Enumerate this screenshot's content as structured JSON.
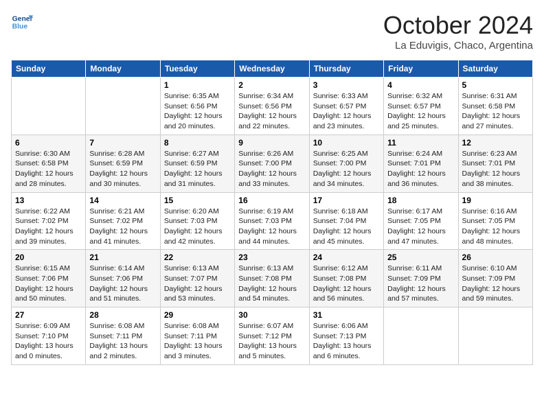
{
  "header": {
    "logo_line1": "General",
    "logo_line2": "Blue",
    "month": "October 2024",
    "location": "La Eduvigis, Chaco, Argentina"
  },
  "weekdays": [
    "Sunday",
    "Monday",
    "Tuesday",
    "Wednesday",
    "Thursday",
    "Friday",
    "Saturday"
  ],
  "weeks": [
    [
      {
        "day": "",
        "content": ""
      },
      {
        "day": "",
        "content": ""
      },
      {
        "day": "1",
        "content": "Sunrise: 6:35 AM\nSunset: 6:56 PM\nDaylight: 12 hours\nand 20 minutes."
      },
      {
        "day": "2",
        "content": "Sunrise: 6:34 AM\nSunset: 6:56 PM\nDaylight: 12 hours\nand 22 minutes."
      },
      {
        "day": "3",
        "content": "Sunrise: 6:33 AM\nSunset: 6:57 PM\nDaylight: 12 hours\nand 23 minutes."
      },
      {
        "day": "4",
        "content": "Sunrise: 6:32 AM\nSunset: 6:57 PM\nDaylight: 12 hours\nand 25 minutes."
      },
      {
        "day": "5",
        "content": "Sunrise: 6:31 AM\nSunset: 6:58 PM\nDaylight: 12 hours\nand 27 minutes."
      }
    ],
    [
      {
        "day": "6",
        "content": "Sunrise: 6:30 AM\nSunset: 6:58 PM\nDaylight: 12 hours\nand 28 minutes."
      },
      {
        "day": "7",
        "content": "Sunrise: 6:28 AM\nSunset: 6:59 PM\nDaylight: 12 hours\nand 30 minutes."
      },
      {
        "day": "8",
        "content": "Sunrise: 6:27 AM\nSunset: 6:59 PM\nDaylight: 12 hours\nand 31 minutes."
      },
      {
        "day": "9",
        "content": "Sunrise: 6:26 AM\nSunset: 7:00 PM\nDaylight: 12 hours\nand 33 minutes."
      },
      {
        "day": "10",
        "content": "Sunrise: 6:25 AM\nSunset: 7:00 PM\nDaylight: 12 hours\nand 34 minutes."
      },
      {
        "day": "11",
        "content": "Sunrise: 6:24 AM\nSunset: 7:01 PM\nDaylight: 12 hours\nand 36 minutes."
      },
      {
        "day": "12",
        "content": "Sunrise: 6:23 AM\nSunset: 7:01 PM\nDaylight: 12 hours\nand 38 minutes."
      }
    ],
    [
      {
        "day": "13",
        "content": "Sunrise: 6:22 AM\nSunset: 7:02 PM\nDaylight: 12 hours\nand 39 minutes."
      },
      {
        "day": "14",
        "content": "Sunrise: 6:21 AM\nSunset: 7:02 PM\nDaylight: 12 hours\nand 41 minutes."
      },
      {
        "day": "15",
        "content": "Sunrise: 6:20 AM\nSunset: 7:03 PM\nDaylight: 12 hours\nand 42 minutes."
      },
      {
        "day": "16",
        "content": "Sunrise: 6:19 AM\nSunset: 7:03 PM\nDaylight: 12 hours\nand 44 minutes."
      },
      {
        "day": "17",
        "content": "Sunrise: 6:18 AM\nSunset: 7:04 PM\nDaylight: 12 hours\nand 45 minutes."
      },
      {
        "day": "18",
        "content": "Sunrise: 6:17 AM\nSunset: 7:05 PM\nDaylight: 12 hours\nand 47 minutes."
      },
      {
        "day": "19",
        "content": "Sunrise: 6:16 AM\nSunset: 7:05 PM\nDaylight: 12 hours\nand 48 minutes."
      }
    ],
    [
      {
        "day": "20",
        "content": "Sunrise: 6:15 AM\nSunset: 7:06 PM\nDaylight: 12 hours\nand 50 minutes."
      },
      {
        "day": "21",
        "content": "Sunrise: 6:14 AM\nSunset: 7:06 PM\nDaylight: 12 hours\nand 51 minutes."
      },
      {
        "day": "22",
        "content": "Sunrise: 6:13 AM\nSunset: 7:07 PM\nDaylight: 12 hours\nand 53 minutes."
      },
      {
        "day": "23",
        "content": "Sunrise: 6:13 AM\nSunset: 7:08 PM\nDaylight: 12 hours\nand 54 minutes."
      },
      {
        "day": "24",
        "content": "Sunrise: 6:12 AM\nSunset: 7:08 PM\nDaylight: 12 hours\nand 56 minutes."
      },
      {
        "day": "25",
        "content": "Sunrise: 6:11 AM\nSunset: 7:09 PM\nDaylight: 12 hours\nand 57 minutes."
      },
      {
        "day": "26",
        "content": "Sunrise: 6:10 AM\nSunset: 7:09 PM\nDaylight: 12 hours\nand 59 minutes."
      }
    ],
    [
      {
        "day": "27",
        "content": "Sunrise: 6:09 AM\nSunset: 7:10 PM\nDaylight: 13 hours\nand 0 minutes."
      },
      {
        "day": "28",
        "content": "Sunrise: 6:08 AM\nSunset: 7:11 PM\nDaylight: 13 hours\nand 2 minutes."
      },
      {
        "day": "29",
        "content": "Sunrise: 6:08 AM\nSunset: 7:11 PM\nDaylight: 13 hours\nand 3 minutes."
      },
      {
        "day": "30",
        "content": "Sunrise: 6:07 AM\nSunset: 7:12 PM\nDaylight: 13 hours\nand 5 minutes."
      },
      {
        "day": "31",
        "content": "Sunrise: 6:06 AM\nSunset: 7:13 PM\nDaylight: 13 hours\nand 6 minutes."
      },
      {
        "day": "",
        "content": ""
      },
      {
        "day": "",
        "content": ""
      }
    ]
  ]
}
